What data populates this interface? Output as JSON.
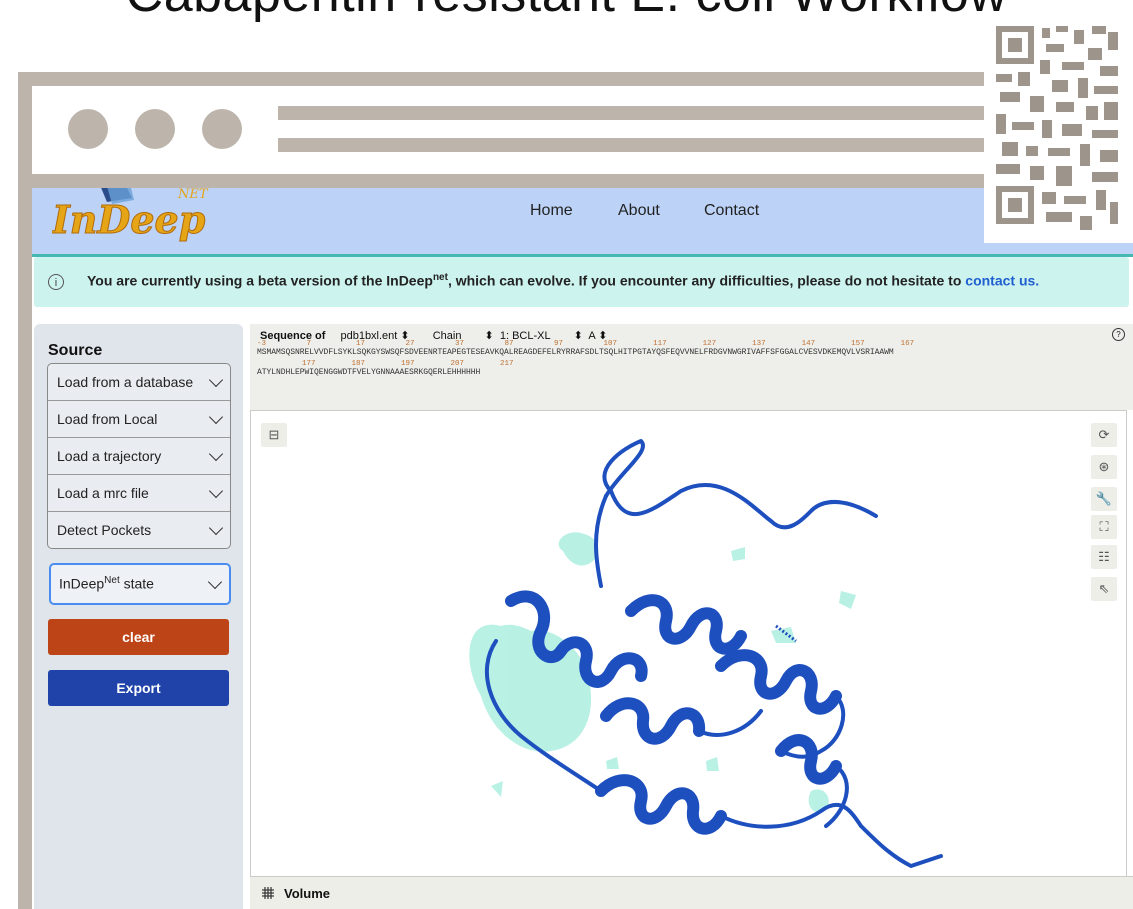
{
  "page": {
    "heading": "Cabapentin-resistant E. coli Workflow"
  },
  "navbar": {
    "logo_text": "InDeep",
    "logo_sup": "NET",
    "links": [
      "Home",
      "About",
      "Contact"
    ]
  },
  "banner": {
    "text_before": "You are currently using a beta version of the InDeep",
    "text_sup": "net",
    "text_after": ", which can evolve. If you encounter any difficulties, please do not hesitate to",
    "link": "contact us."
  },
  "sidebar": {
    "title": "Source",
    "items": [
      "Load from a database",
      "Load from Local",
      "Load a trajectory",
      "Load a mrc file",
      "Detect Pockets"
    ],
    "state_label": "InDeep",
    "state_sup": "Net",
    "state_suffix": " state",
    "clear_label": "clear",
    "export_label": "Export"
  },
  "sequence": {
    "label": "Sequence of",
    "file": "pdb1bxl.ent",
    "chain_label": "Chain",
    "entity": "1: BCL-XL",
    "chain": "A",
    "numbers_line1": "-3         7          17         27         37         87         97         107        117        127        137        147        157        167",
    "residues_line1": "MSMAMSQSNRELVVDFLSYKLSQKGYSWSQFSDVEENRTEAPEGTESEAVKQALREAGDEFELRYRRAFSDLTSQLHITPGTAYQSFEQVVNELFRDGVNWGRIVAFFSFGGALCVESVDKEMQVLVSRIAAWM",
    "numbers_line2": "          177        187        197        207        217",
    "residues_line2": "ATYLNDHLEPWIQENGGWDTFVELYGNNAAAESRKGQERLEHHHHHH"
  },
  "viewer": {
    "tools": [
      "rotate-icon",
      "target-icon",
      "wrench-icon",
      "expand-icon",
      "settings-icon",
      "pointer-icon"
    ]
  },
  "volume_panel": {
    "label": "Volume"
  },
  "colors": {
    "navbar": "#bcd2f7",
    "banner": "#cdf3ef",
    "clear": "#bd4416",
    "export": "#1f43a8",
    "protein": "#1d4fbf",
    "density": "#7fe6cf"
  }
}
